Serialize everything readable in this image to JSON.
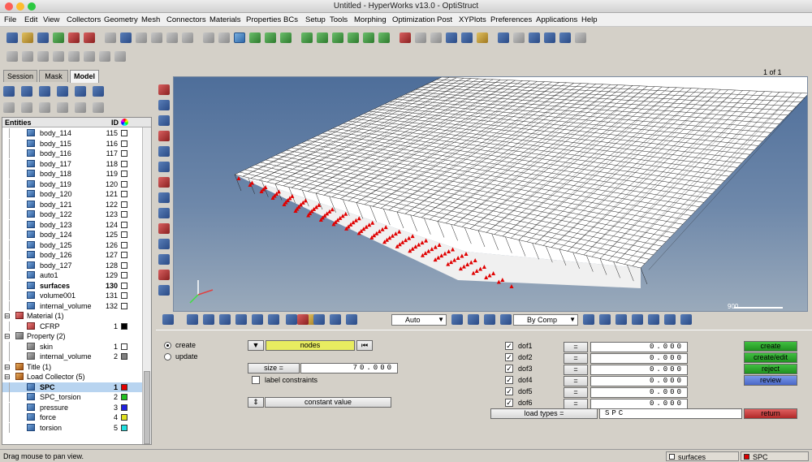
{
  "window": {
    "title": "Untitled - HyperWorks v13.0 - OptiStruct"
  },
  "menu": [
    "File",
    "Edit",
    "View",
    "Collectors",
    "Geometry",
    "Mesh",
    "Connectors",
    "Materials",
    "Properties",
    "BCs",
    "Setup",
    "Tools",
    "Morphing",
    "Optimization",
    "Post",
    "XYPlots",
    "Preferences",
    "Applications",
    "Help"
  ],
  "page_indicator": "1 of 1",
  "browser": {
    "tabs": [
      "Session",
      "Mask",
      "Model"
    ],
    "header": {
      "entities": "Entities",
      "id": "ID"
    },
    "rows": [
      {
        "label": "body_114",
        "id": "115",
        "indent": 2,
        "icon": "comp"
      },
      {
        "label": "body_115",
        "id": "116",
        "indent": 2,
        "icon": "comp"
      },
      {
        "label": "body_116",
        "id": "117",
        "indent": 2,
        "icon": "comp"
      },
      {
        "label": "body_117",
        "id": "118",
        "indent": 2,
        "icon": "comp"
      },
      {
        "label": "body_118",
        "id": "119",
        "indent": 2,
        "icon": "comp"
      },
      {
        "label": "body_119",
        "id": "120",
        "indent": 2,
        "icon": "comp"
      },
      {
        "label": "body_120",
        "id": "121",
        "indent": 2,
        "icon": "comp"
      },
      {
        "label": "body_121",
        "id": "122",
        "indent": 2,
        "icon": "comp"
      },
      {
        "label": "body_122",
        "id": "123",
        "indent": 2,
        "icon": "comp"
      },
      {
        "label": "body_123",
        "id": "124",
        "indent": 2,
        "icon": "comp"
      },
      {
        "label": "body_124",
        "id": "125",
        "indent": 2,
        "icon": "comp"
      },
      {
        "label": "body_125",
        "id": "126",
        "indent": 2,
        "icon": "comp"
      },
      {
        "label": "body_126",
        "id": "127",
        "indent": 2,
        "icon": "comp"
      },
      {
        "label": "body_127",
        "id": "128",
        "indent": 2,
        "icon": "comp"
      },
      {
        "label": "auto1",
        "id": "129",
        "indent": 2,
        "icon": "comp"
      },
      {
        "label": "surfaces",
        "id": "130",
        "indent": 2,
        "icon": "comp",
        "bold": true
      },
      {
        "label": "volume001",
        "id": "131",
        "indent": 2,
        "icon": "comp"
      },
      {
        "label": "internal_volume",
        "id": "132",
        "indent": 2,
        "icon": "comp"
      },
      {
        "label": "Material (1)",
        "id": "",
        "indent": 0,
        "icon": "mat",
        "folder": true
      },
      {
        "label": "CFRP",
        "id": "1",
        "indent": 2,
        "icon": "mat",
        "color": "#000000"
      },
      {
        "label": "Property (2)",
        "id": "",
        "indent": 0,
        "icon": "prop",
        "folder": true
      },
      {
        "label": "skin",
        "id": "1",
        "indent": 2,
        "icon": "prop",
        "color": "#ffffff"
      },
      {
        "label": "internal_volume",
        "id": "2",
        "indent": 2,
        "icon": "prop",
        "color": "#808080"
      },
      {
        "label": "Title (1)",
        "id": "",
        "indent": 0,
        "icon": "lc",
        "folder": true
      },
      {
        "label": "Load Collector (5)",
        "id": "",
        "indent": 0,
        "icon": "lc",
        "folder": true
      },
      {
        "label": "SPC",
        "id": "1",
        "indent": 2,
        "icon": "comp",
        "color": "#e00000",
        "bold": true,
        "selected": true
      },
      {
        "label": "SPC_torsion",
        "id": "2",
        "indent": 2,
        "icon": "comp",
        "color": "#20c020"
      },
      {
        "label": "pressure",
        "id": "3",
        "indent": 2,
        "icon": "comp",
        "color": "#2020e0"
      },
      {
        "label": "force",
        "id": "4",
        "indent": 2,
        "icon": "comp",
        "color": "#e0e020"
      },
      {
        "label": "torsion",
        "id": "5",
        "indent": 2,
        "icon": "comp",
        "color": "#20e0e0"
      }
    ]
  },
  "graphics": {
    "scale_label": "900"
  },
  "bottom_toolbar": {
    "auto_select": "Auto",
    "color_mode": "By Comp"
  },
  "panel": {
    "mode_create": "create",
    "mode_update": "update",
    "entity_selector": "nodes",
    "size_label": "size =",
    "size_value": "70.000",
    "label_constraints": "label constraints",
    "value_type": "constant value",
    "dofs": [
      {
        "name": "dof1",
        "eq": "=",
        "value": "0.000"
      },
      {
        "name": "dof2",
        "eq": "=",
        "value": "0.000"
      },
      {
        "name": "dof3",
        "eq": "=",
        "value": "0.000"
      },
      {
        "name": "dof4",
        "eq": "=",
        "value": "0.000"
      },
      {
        "name": "dof5",
        "eq": "=",
        "value": "0.000"
      },
      {
        "name": "dof6",
        "eq": "=",
        "value": "0.000"
      }
    ],
    "load_types_label": "load types =",
    "load_types_value": "SPC",
    "buttons": {
      "create": "create",
      "create_edit": "create/edit",
      "reject": "reject",
      "review": "review",
      "return": "return"
    }
  },
  "status": {
    "message": "Drag mouse to pan view.",
    "collector_current": "surfaces",
    "loadcol_current": "SPC"
  }
}
